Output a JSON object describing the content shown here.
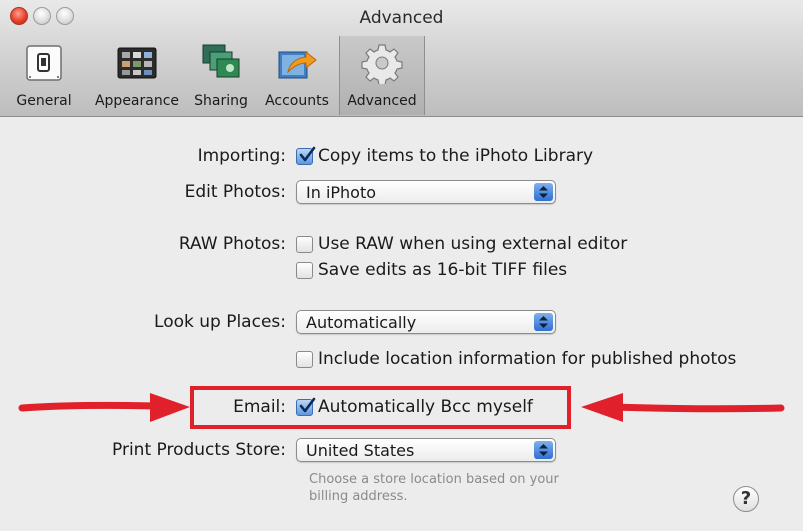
{
  "window": {
    "title": "Advanced"
  },
  "toolbar": {
    "items": [
      {
        "label": "General",
        "icon": "general-switch-icon",
        "selected": false
      },
      {
        "label": "Appearance",
        "icon": "appearance-icon",
        "selected": false
      },
      {
        "label": "Sharing",
        "icon": "sharing-icon",
        "selected": false
      },
      {
        "label": "Accounts",
        "icon": "accounts-icon",
        "selected": false
      },
      {
        "label": "Advanced",
        "icon": "gear-icon",
        "selected": true
      }
    ]
  },
  "settings": {
    "importing": {
      "label": "Importing:",
      "option": "Copy items to the iPhoto Library",
      "checked": true
    },
    "edit_photos": {
      "label": "Edit Photos:",
      "value": "In iPhoto"
    },
    "raw_photos": {
      "label": "RAW Photos:",
      "options": [
        {
          "text": "Use RAW when using external editor",
          "checked": false
        },
        {
          "text": "Save edits as 16-bit TIFF files",
          "checked": false
        }
      ]
    },
    "look_up_places": {
      "label": "Look up Places:",
      "value": "Automatically",
      "option": "Include location information for published photos",
      "checked": false
    },
    "email": {
      "label": "Email:",
      "option": "Automatically Bcc myself",
      "checked": true
    },
    "print_store": {
      "label": "Print Products Store:",
      "value": "United States",
      "hint_line1": "Choose a store location based on your",
      "hint_line2": "billing address."
    }
  },
  "help": {
    "label": "?"
  },
  "annotation": {
    "color": "#e0212b"
  }
}
